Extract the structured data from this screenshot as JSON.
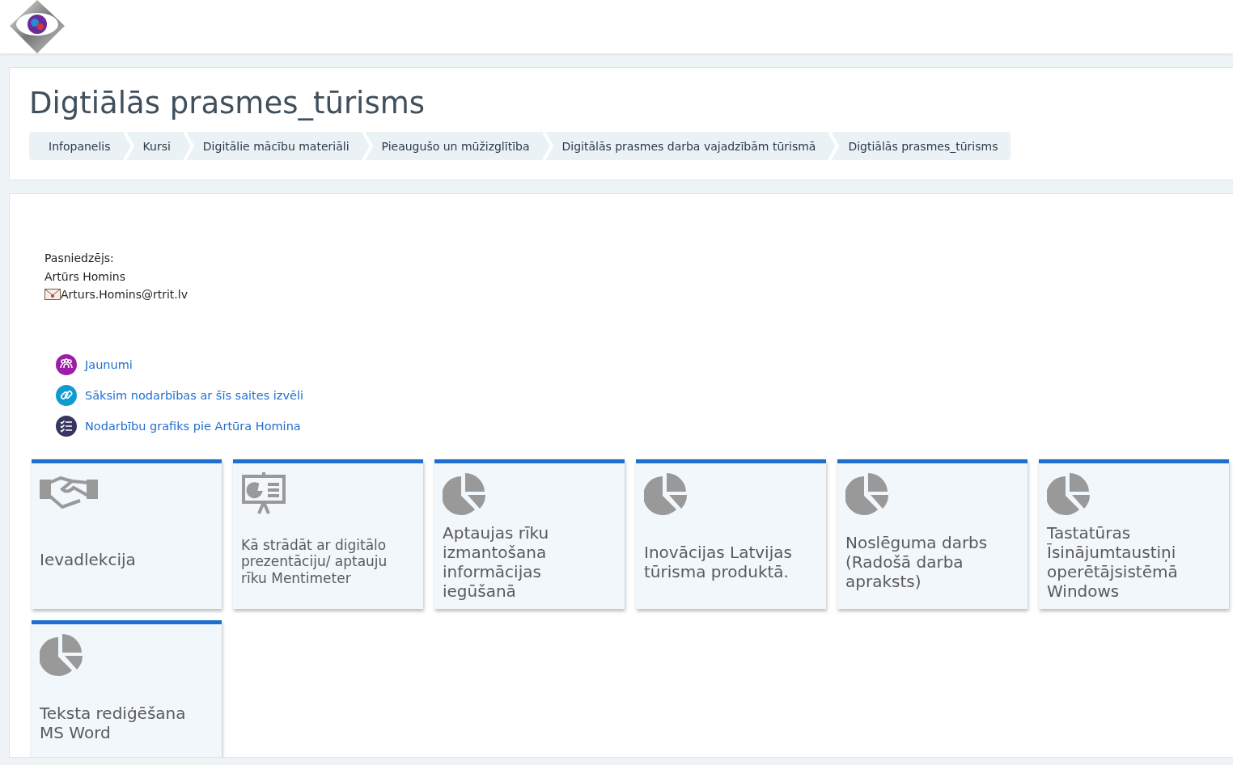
{
  "course_title": "Digtiālās prasmes_tūrisms",
  "breadcrumb": [
    "Infopanelis",
    "Kursi",
    "Digitālie mācību materiāli",
    "Pieaugušo un mūžizglītība",
    "Digitālās prasmes darba vajadzībām tūrismā",
    "Digtiālās prasmes_tūrisms"
  ],
  "teacher": {
    "label": "Pasniedzējs:",
    "name": "Artūrs Homins",
    "email": "Arturs.Homins@rtrit.lv"
  },
  "activities": [
    {
      "kind": "forum",
      "label": "Jaunumi",
      "color": "#9c1ea6"
    },
    {
      "kind": "url",
      "label": "Sāksim nodarbības ar šīs saites izvēli",
      "color": "#109bd0"
    },
    {
      "kind": "checklist",
      "label": "Nodarbību grafiks pie Artūra Homina",
      "color": "#373561"
    }
  ],
  "tiles": [
    {
      "kind": "handshake",
      "title": "Ievadlekcija"
    },
    {
      "kind": "presentation",
      "title": "Kā strādāt ar digitālo prezentāciju/ aptauju rīku Mentimeter"
    },
    {
      "kind": "pie",
      "title": "Aptaujas rīku izmantošana informācijas iegūšanā"
    },
    {
      "kind": "pie",
      "title": "Inovācijas Latvijas tūrisma produktā."
    },
    {
      "kind": "pie",
      "title": "Noslēguma darbs (Radošā darba apraksts)"
    },
    {
      "kind": "pie",
      "title": "Tastatūras Īsinājumtaustiņi operētājsistēmā Windows"
    },
    {
      "kind": "pie",
      "title": "Teksta rediģēšana MS Word"
    }
  ]
}
